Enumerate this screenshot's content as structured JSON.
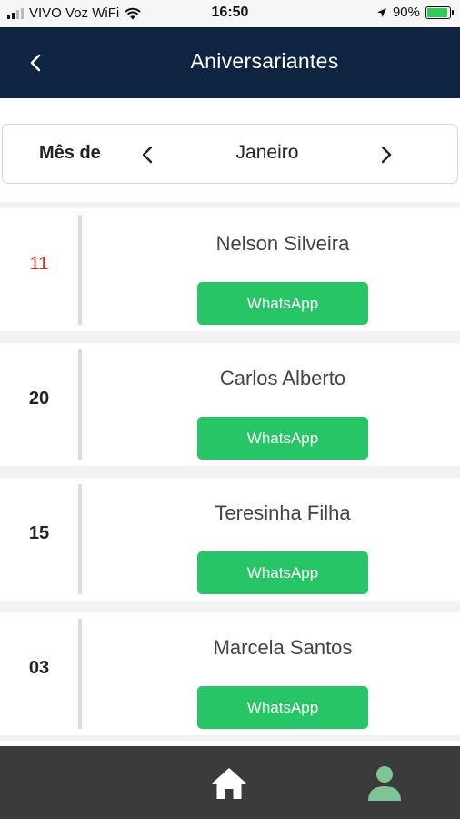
{
  "status_bar": {
    "carrier": "VIVO Voz WiFi",
    "time": "16:50",
    "battery": "90%",
    "battery_level": 0.9,
    "icons": [
      "signal-icon",
      "wifi-icon",
      "location-arrow-icon",
      "battery-charging-icon"
    ]
  },
  "header": {
    "title": "Aniversariantes",
    "back_icon": "chevron-left-icon",
    "background": "#0f2440"
  },
  "month_selector": {
    "label": "Mês de",
    "value": "Janeiro",
    "prev_icon": "chevron-left-icon",
    "next_icon": "chevron-right-icon"
  },
  "birthdays": [
    {
      "day": "11",
      "name": "Nelson Silveira",
      "button": "WhatsApp",
      "highlight": true
    },
    {
      "day": "20",
      "name": "Carlos Alberto",
      "button": "WhatsApp",
      "highlight": false
    },
    {
      "day": "15",
      "name": "Teresinha Filha",
      "button": "WhatsApp",
      "highlight": false
    },
    {
      "day": "03",
      "name": "Marcela Santos",
      "button": "WhatsApp",
      "highlight": false
    }
  ],
  "bottom_nav": {
    "items": [
      {
        "icon": "home-icon",
        "active": false
      },
      {
        "icon": "user-icon",
        "active": true
      }
    ]
  },
  "colors": {
    "header": "#0f2440",
    "whatsapp_button": "#27c566",
    "highlight_day": "#e02020",
    "bottom_nav": "#3b3b3b",
    "active_nav_icon": "#7fc494"
  }
}
